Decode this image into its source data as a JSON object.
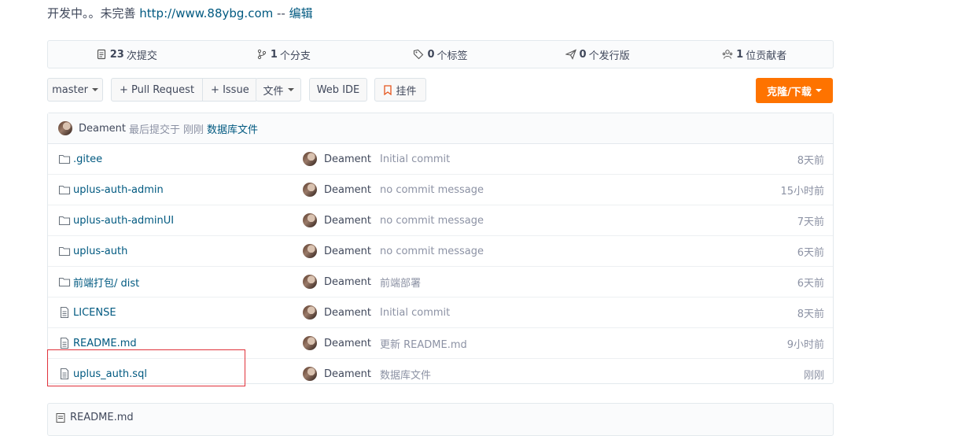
{
  "description": {
    "text": "开发中。。未完善 ",
    "link": "http://www.88ybg.com",
    "sep": " -- ",
    "edit": "编辑"
  },
  "stats": [
    {
      "count": "23",
      "label": "次提交",
      "icon": "commits-icon"
    },
    {
      "count": "1",
      "label": "个分支",
      "icon": "branch-icon"
    },
    {
      "count": "0",
      "label": "个标签",
      "icon": "tag-icon"
    },
    {
      "count": "0",
      "label": "个发行版",
      "icon": "release-icon"
    },
    {
      "count": "1",
      "label": "位贡献者",
      "icon": "contributors-icon"
    }
  ],
  "toolbar": {
    "branch": "master",
    "pull_request": "+ Pull Request",
    "issue": "+ Issue",
    "file": "文件",
    "web_ide": "Web IDE",
    "pendant": "挂件",
    "clone": "克隆/下载"
  },
  "last_commit": {
    "author": "Deament",
    "prefix": "最后提交于",
    "time": "刚刚",
    "message": "数据库文件"
  },
  "files": [
    {
      "type": "folder",
      "name": ".gitee",
      "author": "Deament",
      "message": "Initial commit",
      "time": "8天前"
    },
    {
      "type": "folder",
      "name": "uplus-auth-admin",
      "author": "Deament",
      "message": "no commit message",
      "time": "15小时前"
    },
    {
      "type": "folder",
      "name": "uplus-auth-adminUI",
      "author": "Deament",
      "message": "no commit message",
      "time": "7天前"
    },
    {
      "type": "folder",
      "name": "uplus-auth",
      "author": "Deament",
      "message": "no commit message",
      "time": "6天前"
    },
    {
      "type": "folder",
      "name": "前端打包/ dist",
      "author": "Deament",
      "message": "前端部署",
      "time": "6天前"
    },
    {
      "type": "file",
      "name": "LICENSE",
      "author": "Deament",
      "message": "Initial commit",
      "time": "8天前"
    },
    {
      "type": "file",
      "name": "README.md",
      "author": "Deament",
      "message": "更新 README.md",
      "time": "9小时前"
    },
    {
      "type": "file",
      "name": "uplus_auth.sql",
      "author": "Deament",
      "message": "数据库文件",
      "time": "刚刚"
    }
  ],
  "readme": {
    "title": "README.md"
  },
  "colors": {
    "accent": "#fe7300",
    "link": "#005980",
    "highlight": "#e0323b"
  }
}
